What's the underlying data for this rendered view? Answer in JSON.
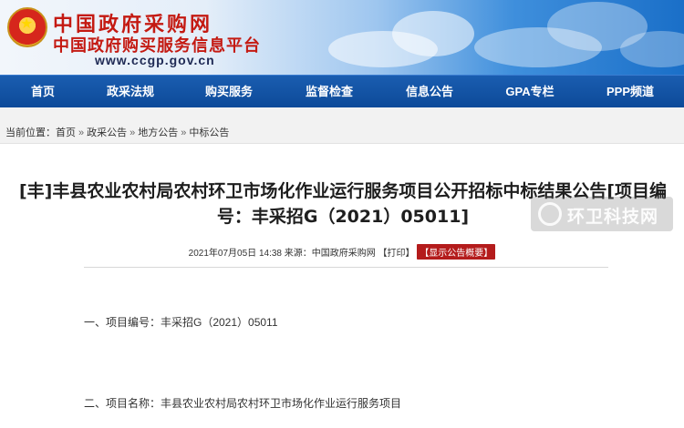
{
  "header": {
    "site_name": "中国政府采购网",
    "site_subtitle": "中国政府购买服务信息平台",
    "site_url": "www.ccgp.gov.cn"
  },
  "nav": {
    "items": [
      {
        "label": "首页"
      },
      {
        "label": "政采法规"
      },
      {
        "label": "购买服务"
      },
      {
        "label": "监督检查"
      },
      {
        "label": "信息公告"
      },
      {
        "label": "GPA专栏"
      },
      {
        "label": "PPP频道"
      }
    ]
  },
  "breadcrumb": {
    "prefix": "当前位置：",
    "items": [
      {
        "label": "首页"
      },
      {
        "label": "政采公告"
      },
      {
        "label": "地方公告"
      },
      {
        "label": "中标公告"
      }
    ],
    "separator": "»"
  },
  "article": {
    "title": "[丰]丰县农业农村局农村环卫市场化作业运行服务项目公开招标中标结果公告[项目编号：丰采招G（2021）05011]",
    "date": "2021年07月05日 14:38",
    "source": "来源：中国政府采购网",
    "print_label": "【打印】",
    "summary_label": "【显示公告概要】",
    "paragraphs": [
      "一、项目编号：丰采招G（2021）05011",
      "二、项目名称：丰县农业农村局农村环卫市场化作业运行服务项目"
    ]
  },
  "watermark": {
    "text": "环卫科技网"
  },
  "colors": {
    "nav_bg": "#0d4a99",
    "site_red": "#c41a12",
    "summary_badge": "#b41c1c"
  }
}
